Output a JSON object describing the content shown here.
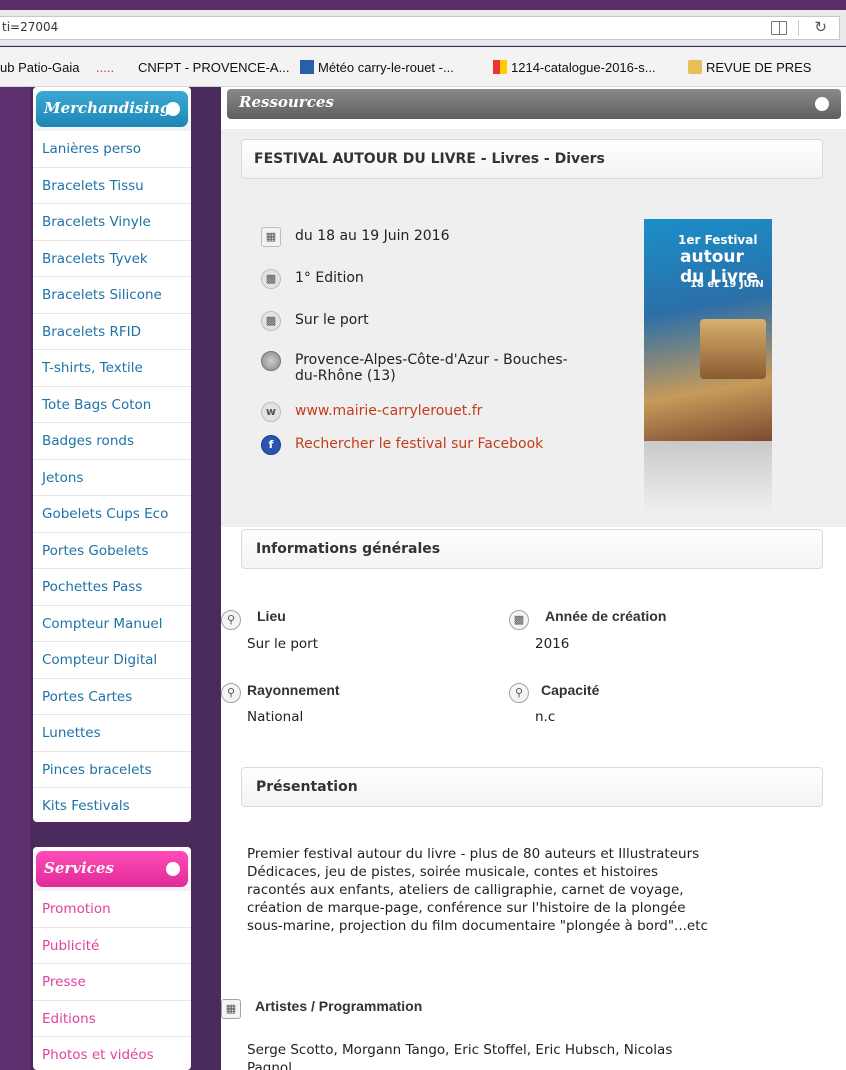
{
  "browser": {
    "url": "ti=27004",
    "bookmarks": [
      "ub Patio-Gaia",
      ".....",
      "CNFPT - PROVENCE-A...",
      "Météo carry-le-rouet -...",
      "1214-catalogue-2016-s...",
      "REVUE DE PRES"
    ]
  },
  "sidebar": {
    "merch": {
      "title": "Merchandising",
      "items": [
        "Lanières perso",
        "Bracelets Tissu",
        "Bracelets Vinyle",
        "Bracelets Tyvek",
        "Bracelets Silicone",
        "Bracelets RFID",
        "T-shirts, Textile",
        "Tote Bags Coton",
        "Badges ronds",
        "Jetons",
        "Gobelets Cups Eco",
        "Portes Gobelets",
        "Pochettes Pass",
        "Compteur Manuel",
        "Compteur Digital",
        "Portes Cartes",
        "Lunettes",
        "Pinces bracelets",
        "Kits Festivals"
      ]
    },
    "services": {
      "title": "Services",
      "items": [
        "Promotion",
        "Publicité",
        "Presse",
        "Editions",
        "Photos et vidéos"
      ]
    }
  },
  "main": {
    "resources_title": "Ressources",
    "event_title": "FESTIVAL AUTOUR DU LIVRE -  Livres - Divers",
    "dates": "du  18 au 19 Juin 2016",
    "edition": "1° Edition",
    "location": "Sur le port",
    "region": [
      "Provence-Alpes-Côte-d'Azur - Bouches-",
      "du-Rhône (13)"
    ],
    "website": "www.mairie-carrylerouet.fr",
    "facebook": "Rechercher le festival sur Facebook",
    "poster": {
      "line1": "1er Festival",
      "line2": "autour du Livre",
      "date": "18 et 19 JUIN"
    },
    "general_title": "Informations générales",
    "lieu_label": "Lieu",
    "lieu_value": "Sur le port",
    "annee_label": "Année de création",
    "annee_value": "2016",
    "rayonnement_label": "Rayonnement",
    "rayonnement_value": "National",
    "capacite_label": "Capacité",
    "capacite_value": "n.c",
    "presentation_title": "Présentation",
    "presentation_lines": [
      "Premier festival autour du livre - plus de 80 auteurs et Illustrateurs",
      "Dédicaces, jeu de pistes, soirée musicale, contes et histoires",
      "racontés aux enfants, ateliers de calligraphie, carnet de voyage,",
      "création de marque-page, conférence sur l'histoire de la plongée",
      "sous-marine, projection du film documentaire \"plongée à bord\"...etc"
    ],
    "artists_label": "Artistes / Programmation",
    "artists_lines": [
      "Serge Scotto, Morgann Tango, Eric Stoffel, Eric Hubsch, Nicolas",
      "Pagnol..."
    ]
  }
}
